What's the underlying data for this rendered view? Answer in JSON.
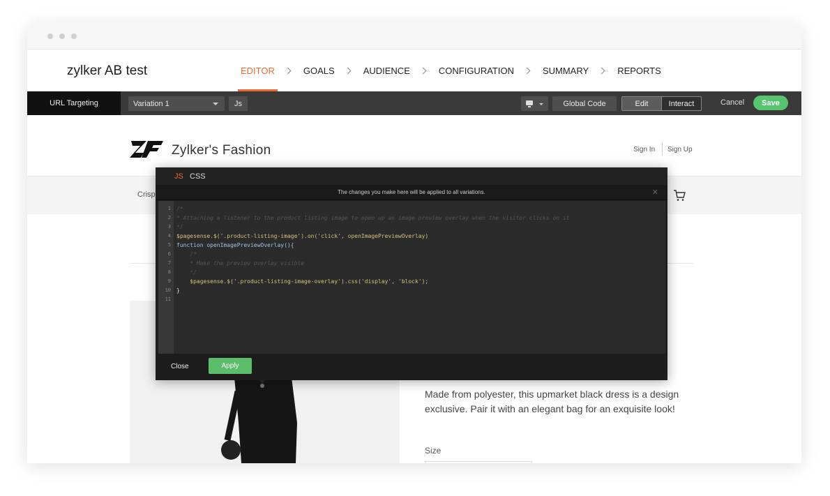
{
  "app": {
    "title": "zylker AB test",
    "steps": [
      "EDITOR",
      "GOALS",
      "AUDIENCE",
      "CONFIGURATION",
      "SUMMARY",
      "REPORTS"
    ],
    "active_step": "EDITOR"
  },
  "toolbar": {
    "url_targeting": "URL Targeting",
    "variation": "Variation 1",
    "js": "Js",
    "global_code": "Global Code",
    "edit": "Edit",
    "interact": "Interact",
    "cancel": "Cancel",
    "save": "Save"
  },
  "site": {
    "brand": "Zylker's Fashion",
    "sign_in": "Sign In",
    "sign_up": "Sign Up",
    "nav_partial": "Crisp",
    "description": "Made from polyester, this upmarket black dress is a design exclusive. Pair it with an elegant bag for an exquisite look!",
    "size_label": "Size"
  },
  "editor": {
    "tab_js": "JS",
    "tab_css": "CSS",
    "notice": "The changes you make here will be applied to all variations.",
    "close": "Close",
    "apply": "Apply",
    "lines": [
      {
        "n": "1",
        "text": "/*",
        "style": "comment"
      },
      {
        "n": "2",
        "text": "* Attaching a listener to the product listing image to open up an image preview overlay when the visitor clicks on it",
        "style": "comment"
      },
      {
        "n": "3",
        "text": "*/",
        "style": "comment"
      },
      {
        "n": "4",
        "text": "$pagesense.$('.product-listing-image').on('click', openImagePreviewOverlay)",
        "style": "code1"
      },
      {
        "n": "5",
        "text": "function openImagePreviewOverlay(){",
        "style": "code2"
      },
      {
        "n": "6",
        "text": "    /*",
        "style": "comment"
      },
      {
        "n": "7",
        "text": "    * Make the preview overlay visible",
        "style": "comment"
      },
      {
        "n": "8",
        "text": "    */",
        "style": "comment"
      },
      {
        "n": "9",
        "text": "    $pagesense.$('.product-listing-image-overlay').css('display', 'block');",
        "style": "code1"
      },
      {
        "n": "10",
        "text": "}",
        "style": "code3"
      },
      {
        "n": "11",
        "text": "",
        "style": "code3"
      }
    ]
  },
  "colors": {
    "accent": "#f0692e",
    "save": "#58c46f",
    "toolbar": "#3a3a3a"
  }
}
